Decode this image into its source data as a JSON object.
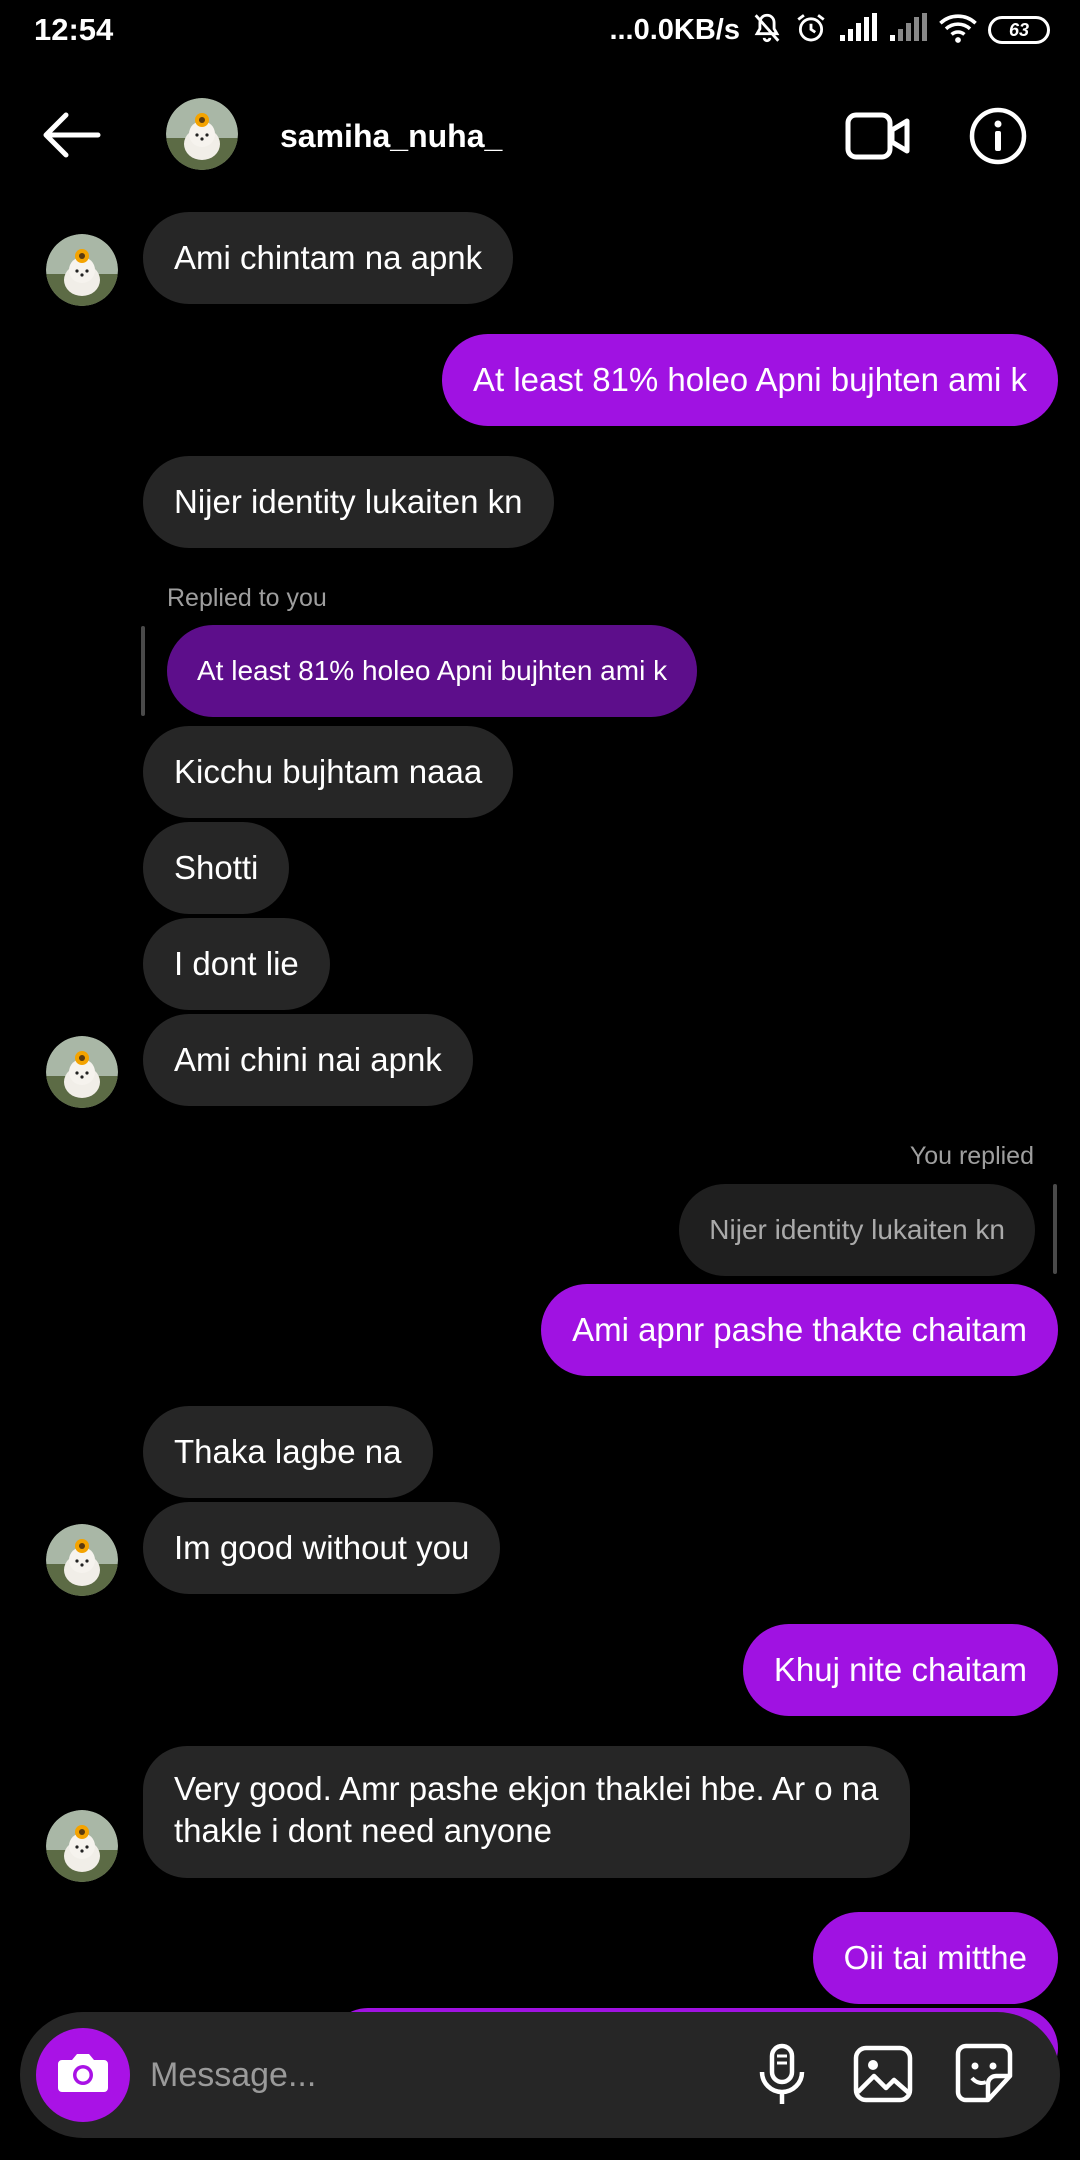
{
  "status_bar": {
    "time": "12:54",
    "network_speed": "...0.0KB/s",
    "battery": "63"
  },
  "header": {
    "username": "samiha_nuha_"
  },
  "messages": [
    {
      "text": "Ami chintam na apnk"
    },
    {
      "text": "At least 81% holeo Apni bujhten ami k"
    },
    {
      "text": "Nijer identity lukaiten kn"
    },
    {
      "reply_label": "Replied to you",
      "quoted": "At least 81% holeo Apni bujhten ami k"
    },
    {
      "text": "Kicchu bujhtam naaa"
    },
    {
      "text": "Shotti"
    },
    {
      "text": "I dont lie"
    },
    {
      "text": "Ami chini nai apnk"
    },
    {
      "reply_label": "You replied",
      "quoted": "Nijer identity lukaiten kn"
    },
    {
      "text": "Ami apnr pashe thakte chaitam"
    },
    {
      "text": "Thaka lagbe na"
    },
    {
      "text": "Im good without you"
    },
    {
      "text": "Khuj nite chaitam"
    },
    {
      "text": "Very good. Amr pashe ekjon thaklei hbe. Ar o na thakle i dont need anyone"
    },
    {
      "text": "Oii tai mitthe"
    }
  ],
  "composer": {
    "placeholder": "Message..."
  },
  "colors": {
    "outgoing_bubble": "#a012e2",
    "incoming_bubble": "#262626",
    "quoted_outgoing": "#5d0e8b",
    "camera_button": "#a912e6",
    "background": "#000000"
  },
  "icons": [
    "back-arrow-icon",
    "video-call-icon",
    "info-icon",
    "camera-icon",
    "microphone-icon",
    "gallery-icon",
    "sticker-icon",
    "mute-icon",
    "alarm-icon",
    "signal-icon",
    "wifi-icon"
  ]
}
